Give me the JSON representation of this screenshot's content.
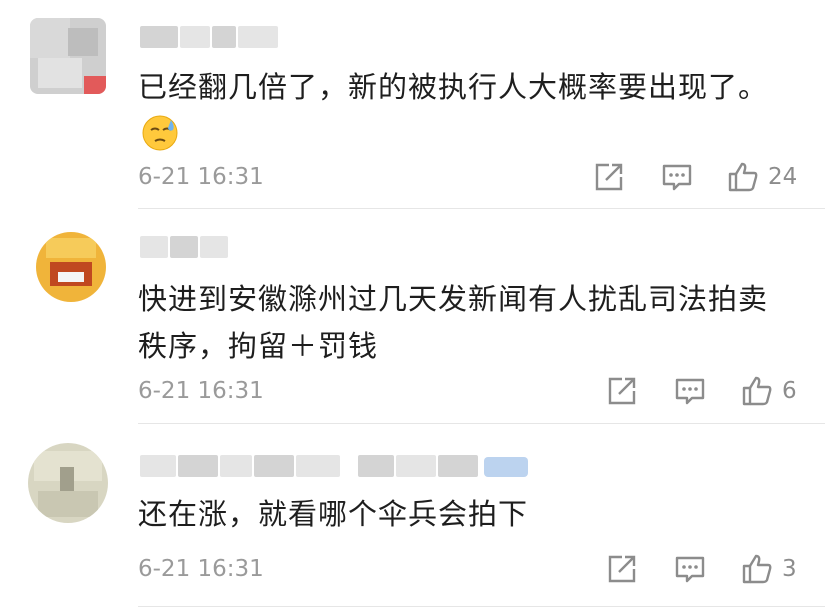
{
  "comments": [
    {
      "text": "已经翻几倍了，新的被执行人大概率要出现了。",
      "emoji": "sweat-face-emoji",
      "time": "6-21 16:31",
      "likes": "24"
    },
    {
      "text_line1": "快进到安徽滁州过几天发新闻有人扰乱司法拍卖",
      "text_line2": "秩序，拘留＋罚钱",
      "time": "6-21 16:31",
      "likes": "6"
    },
    {
      "text": "还在涨，就看哪个伞兵会拍下",
      "time": "6-21 16:31",
      "likes": "3"
    }
  ],
  "colors": {
    "text": "#1e1e1e",
    "meta": "#9a9a9a",
    "icon": "#8c8c8c",
    "divider": "#e6e6e6",
    "vip_badge": "#bcd3ef"
  },
  "icons": [
    "share-icon",
    "comment-icon",
    "like-icon"
  ]
}
